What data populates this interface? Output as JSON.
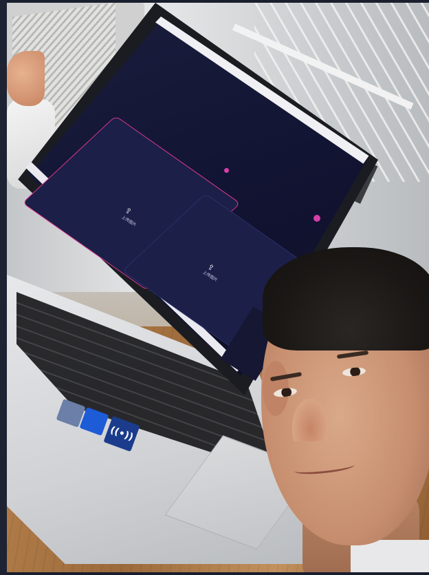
{
  "image": {
    "scene": "selfie-with-laptop",
    "colors": {
      "frame": "#1a1f2e",
      "screen_bg": "#121433",
      "upload_border": "#e0378f",
      "badge": "#d63ea8",
      "desk": "#a77d52"
    }
  },
  "laptop_screen": {
    "upload_panel_a": {
      "label": "上传图片",
      "icon": "upload-icon"
    },
    "upload_panel_b": {
      "label": "上传图片",
      "icon": "upload-icon"
    }
  },
  "stickers": [
    {
      "icon": "sticker-icon"
    },
    {
      "icon": "intel-sticker-icon"
    },
    {
      "icon": "nfc-icon",
      "glyph": "((•))"
    }
  ]
}
